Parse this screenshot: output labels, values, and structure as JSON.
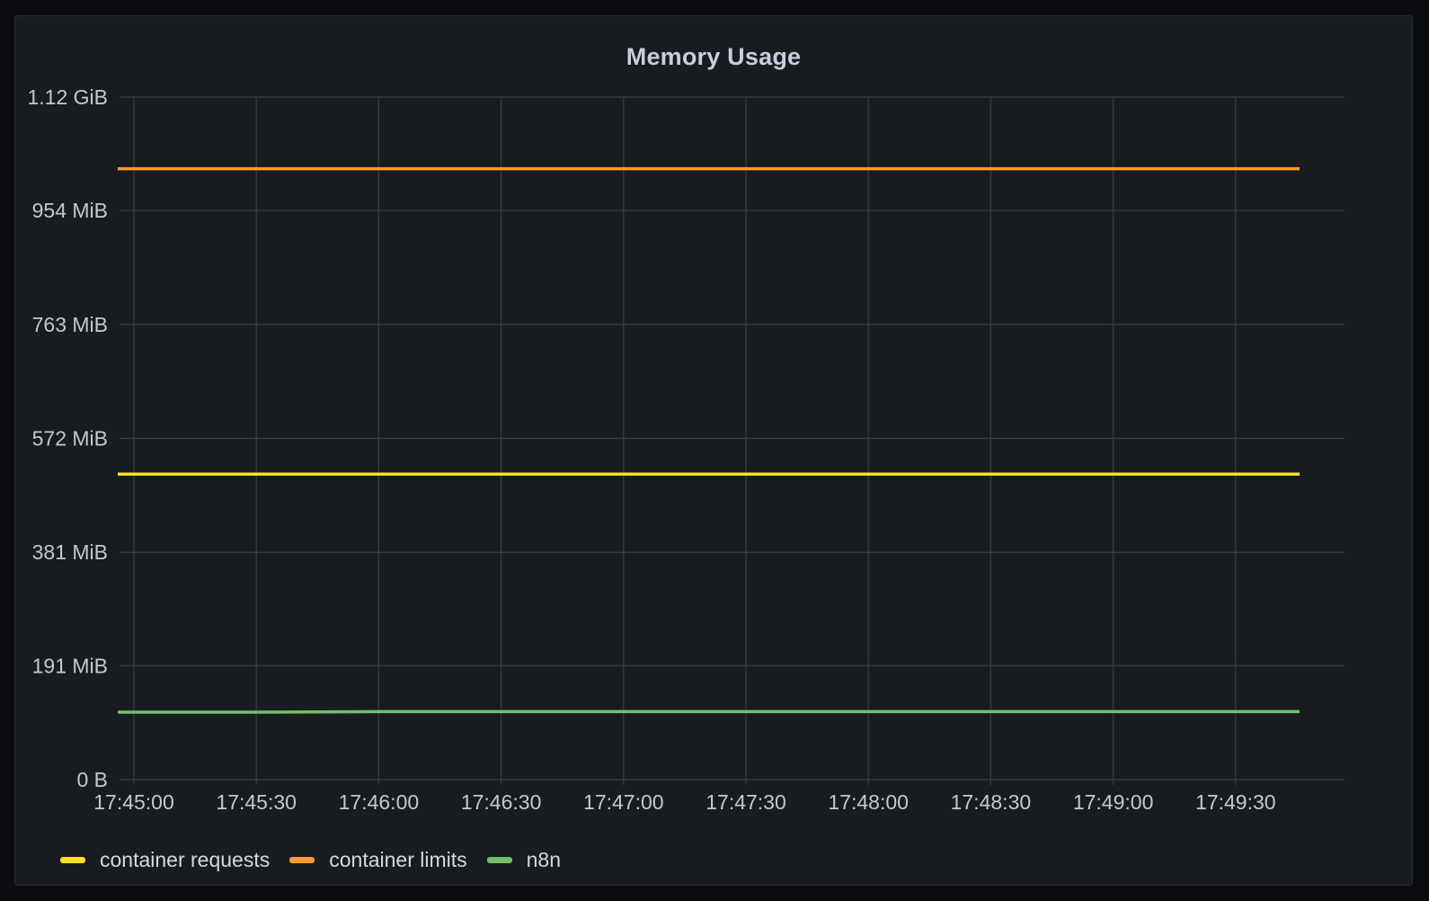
{
  "panel": {
    "title": "Memory Usage"
  },
  "chart_data": {
    "type": "line",
    "title": "Memory Usage",
    "xlabel": "",
    "ylabel": "",
    "x": [
      "17:45:00",
      "17:45:30",
      "17:46:00",
      "17:46:30",
      "17:47:00",
      "17:47:30",
      "17:48:00",
      "17:48:30",
      "17:49:00",
      "17:49:30",
      "17:49:45"
    ],
    "x_ticks": [
      "17:45:00",
      "17:45:30",
      "17:46:00",
      "17:46:30",
      "17:47:00",
      "17:47:30",
      "17:48:00",
      "17:48:30",
      "17:49:00",
      "17:49:30"
    ],
    "y_unit": "MiB",
    "ylim": [
      0,
      1144
    ],
    "y_ticks": [
      {
        "value": 0,
        "label": "0 B"
      },
      {
        "value": 191,
        "label": "191 MiB"
      },
      {
        "value": 381,
        "label": "381 MiB"
      },
      {
        "value": 572,
        "label": "572 MiB"
      },
      {
        "value": 763,
        "label": "763 MiB"
      },
      {
        "value": 954,
        "label": "954 MiB"
      },
      {
        "value": 1144,
        "label": "1.12 GiB"
      }
    ],
    "grid": true,
    "legend_position": "bottom-left",
    "series": [
      {
        "name": "container requests",
        "color": "#fade2a",
        "values": [
          512,
          512,
          512,
          512,
          512,
          512,
          512,
          512,
          512,
          512,
          512
        ]
      },
      {
        "name": "container limits",
        "color": "#ff9830",
        "values": [
          1024,
          1024,
          1024,
          1024,
          1024,
          1024,
          1024,
          1024,
          1024,
          1024,
          1024
        ]
      },
      {
        "name": "n8n",
        "color": "#73bf69",
        "values": [
          113,
          113,
          114,
          114,
          114,
          114,
          114,
          114,
          114,
          114,
          114
        ]
      }
    ]
  }
}
